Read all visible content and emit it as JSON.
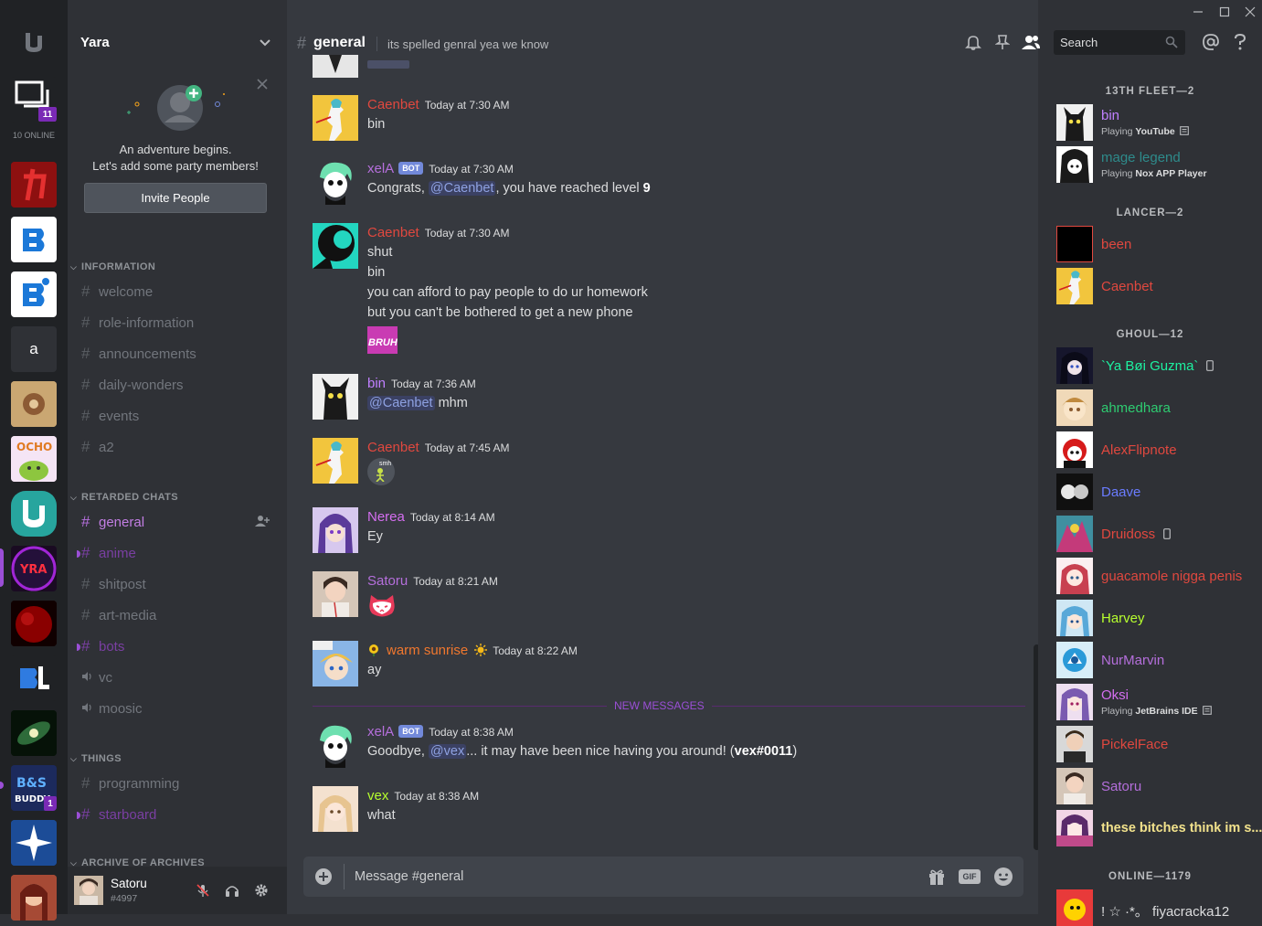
{
  "colors": {
    "accent": "#b56fdc",
    "server_rail": "#202225",
    "sidebar": "#2f3136",
    "chat_bg": "#36393f"
  },
  "window": {
    "controls": [
      "minimize",
      "maximize",
      "close"
    ]
  },
  "servers": {
    "online_badge": "11",
    "online_label": "10 ONLINE",
    "letter_server": "a",
    "server_badge": "1"
  },
  "server_header": {
    "name": "Yara"
  },
  "invite": {
    "line1": "An adventure begins.",
    "line2": "Let's add some party members!",
    "button": "Invite People"
  },
  "categories": {
    "information": "INFORMATION",
    "retarded_chats": "RETARDED CHATS",
    "things": "THINGS",
    "archive": "ARCHIVE OF ARCHIVES"
  },
  "channels": {
    "information": [
      "welcome",
      "role-information",
      "announcements",
      "daily-wonders",
      "events",
      "a2"
    ],
    "retarded_chats": [
      "general",
      "anime",
      "shitpost",
      "art-media",
      "bots"
    ],
    "voice": [
      "vc",
      "moosic"
    ],
    "things": [
      "programming",
      "starboard"
    ]
  },
  "user_panel": {
    "name": "Satoru",
    "tag": "#4997"
  },
  "chat_header": {
    "channel": "general",
    "topic": "its spelled genral yea we know"
  },
  "search": {
    "placeholder": "Search"
  },
  "messages": [
    {
      "user": "Caenbet",
      "time": "Today at 7:30 AM",
      "lines": [
        "bin"
      ],
      "color": "#e0483f"
    },
    {
      "user": "xelA",
      "bot": "BOT",
      "time": "Today at 7:30 AM",
      "color": "#b56fdc",
      "pre": "Congrats, ",
      "mention": "@Caenbet",
      "post": ", you have reached level ",
      "bold": "9"
    },
    {
      "user": "Caenbet",
      "time": "Today at 7:30 AM",
      "lines": [
        "shut",
        "bin",
        "you can afford to pay people to do ur homework",
        "but you can't be bothered to get a new phone"
      ],
      "color": "#e0483f",
      "emoji_text": "BRUH"
    },
    {
      "user": "bin",
      "time": "Today at 7:36 AM",
      "color": "#c080ff",
      "mention": "@Caenbet",
      "post": " mhm"
    },
    {
      "user": "Caenbet",
      "time": "Today at 7:45 AM",
      "color": "#e0483f",
      "emoji_text": "smh"
    },
    {
      "user": "Nerea",
      "time": "Today at 8:14 AM",
      "lines": [
        "Ey"
      ],
      "color": "#d46ef0"
    },
    {
      "user": "Satoru",
      "time": "Today at 8:21 AM",
      "color": "#b56fdc"
    },
    {
      "user": "warm sunrise",
      "time": "Today at 8:22 AM",
      "lines": [
        "ay"
      ],
      "color": "#f0772e"
    },
    {
      "user": "xelA",
      "bot": "BOT",
      "time": "Today at 8:38 AM",
      "color": "#b56fdc",
      "pre": "Goodbye, ",
      "mention": "@vex",
      "post": "... it may have been nice having you around! (",
      "bold": "vex#0011",
      "post2": ")"
    },
    {
      "user": "vex",
      "time": "Today at 8:38 AM",
      "lines": [
        "what"
      ],
      "color": "#b7ff2e"
    }
  ],
  "new_messages_label": "NEW MESSAGES",
  "composer": {
    "placeholder": "Message #general"
  },
  "member_groups": [
    {
      "label": "13TH FLEET—2",
      "members": [
        {
          "name": "bin",
          "color": "#c080ff",
          "status_pre": "Playing ",
          "status_game": "YouTube"
        },
        {
          "name": "mage legend",
          "color": "#2e8b8b",
          "status_pre": "Playing ",
          "status_game": "Nox APP Player"
        }
      ]
    },
    {
      "label": "LANCER—2",
      "members": [
        {
          "name": "been",
          "color": "#e0483f"
        },
        {
          "name": "Caenbet",
          "color": "#e0483f"
        }
      ]
    },
    {
      "label": "GHOUL—12",
      "members": [
        {
          "name": "`Ya Bøi Guzma`",
          "color": "#1df0a0"
        },
        {
          "name": "ahmedhara",
          "color": "#2ecc71"
        },
        {
          "name": "AlexFlipnote",
          "color": "#e0483f"
        },
        {
          "name": "Daave",
          "color": "#6a7cff"
        },
        {
          "name": "Druidoss",
          "color": "#e0483f"
        },
        {
          "name": "guacamole nigga penis",
          "color": "#e0483f"
        },
        {
          "name": "Harvey",
          "color": "#b7ff2e"
        },
        {
          "name": "NurMarvin",
          "color": "#b56fdc"
        },
        {
          "name": "Oksi",
          "color": "#d46ef0",
          "status_pre": "Playing ",
          "status_game": "JetBrains IDE"
        },
        {
          "name": "PickelFace",
          "color": "#e0483f"
        },
        {
          "name": "Satoru",
          "color": "#b56fdc"
        },
        {
          "name": "these bitches think im s...",
          "color": "#f2e28c"
        }
      ]
    },
    {
      "label": "ONLINE—1179",
      "members": [
        {
          "name": "! ☆ ·*。 fiyacracka12",
          "color": "#dcddde"
        }
      ]
    }
  ]
}
